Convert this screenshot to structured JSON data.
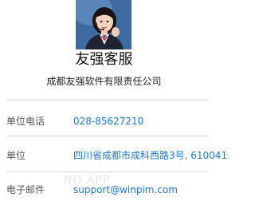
{
  "contact": {
    "name": "友强客服",
    "company": "成都友强软件有限责任公司"
  },
  "fields": [
    {
      "label": "单位电话",
      "value": "028-85627210"
    },
    {
      "label": "单位",
      "value": "四川省成都市成科西路3号, 610041"
    },
    {
      "label": "电子邮件",
      "value": "support@winpim.com"
    }
  ],
  "watermark": "NO      APP",
  "icons": {
    "avatar": "avatar-photo"
  },
  "colors": {
    "link": "#1a78d6",
    "divider": "#d8d8d8",
    "label": "#555555"
  }
}
